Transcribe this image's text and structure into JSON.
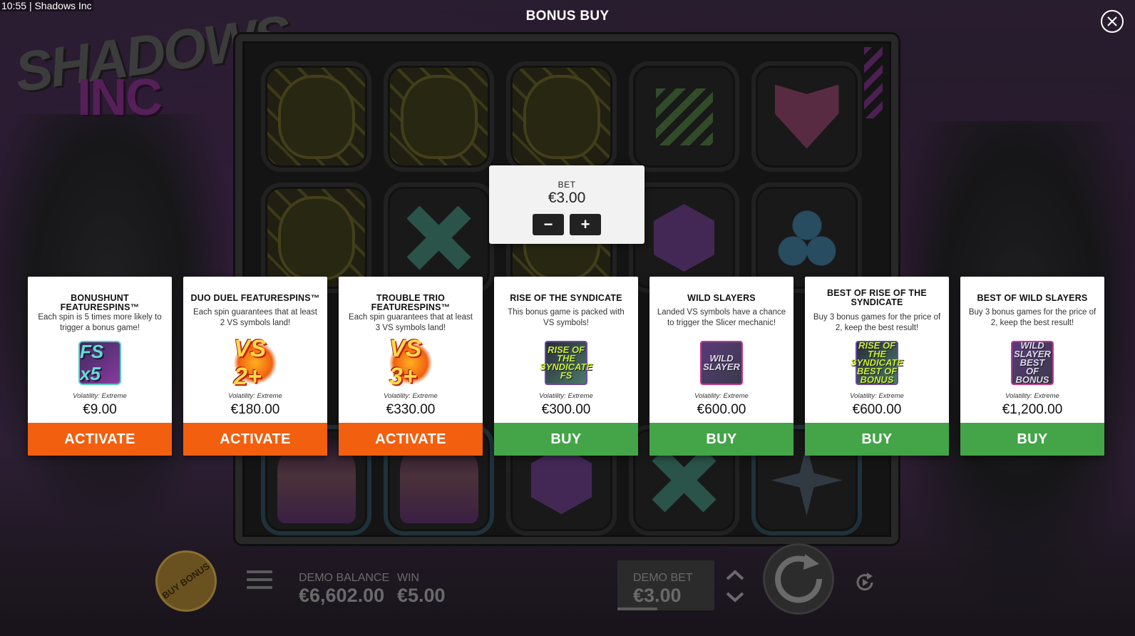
{
  "status_bar": {
    "time": "10:55",
    "app": "Shadows Inc"
  },
  "header": {
    "title": "BONUS BUY"
  },
  "logo": {
    "line1": "SHADOWS",
    "line2": "INC"
  },
  "bet": {
    "label": "BET",
    "value": "€3.00",
    "minus": "−",
    "plus": "+"
  },
  "cards": [
    {
      "title": "BONUSHUNT FEATURESPINS™",
      "desc": "Each spin is 5 times more likely to trigger a bonus game!",
      "badge": "FS x5",
      "volatility": "Volatility: Extreme",
      "price": "€9.00",
      "button": "ACTIVATE"
    },
    {
      "title": "DUO DUEL FEATURESPINS™",
      "desc": "Each spin guarantees that at least 2 VS symbols land!",
      "badge": "VS 2+",
      "volatility": "Volatility: Extreme",
      "price": "€180.00",
      "button": "ACTIVATE"
    },
    {
      "title": "TROUBLE TRIO FEATURESPINS™",
      "desc": "Each spin guarantees that at least 3 VS symbols land!",
      "badge": "VS 3+",
      "volatility": "Volatility: Extreme",
      "price": "€330.00",
      "button": "ACTIVATE"
    },
    {
      "title": "RISE OF THE SYNDICATE",
      "desc": "This bonus game is packed with VS symbols!",
      "badge": "RISE OF THE SYNDICATE FS",
      "volatility": "Volatility: Extreme",
      "price": "€300.00",
      "button": "BUY"
    },
    {
      "title": "WILD SLAYERS",
      "desc": "Landed VS symbols have a chance to trigger the Slicer mechanic!",
      "badge": "WILD SLAYER",
      "volatility": "Volatility: Extreme",
      "price": "€600.00",
      "button": "BUY"
    },
    {
      "title": "BEST OF RISE OF THE SYNDICATE",
      "desc": "Buy 3 bonus games for the price of 2, keep the best result!",
      "badge": "RISE OF THE SYNDICATE BEST OF BONUS",
      "volatility": "Volatility: Extreme",
      "price": "€600.00",
      "button": "BUY"
    },
    {
      "title": "BEST OF WILD SLAYERS",
      "desc": "Buy 3 bonus games for the price of 2, keep the best result!",
      "badge": "WILD SLAYER BEST OF BONUS",
      "volatility": "Volatility: Extreme",
      "price": "€1,200.00",
      "button": "BUY"
    }
  ],
  "hud": {
    "buy_bonus": "BUY BONUS",
    "demo_balance_label": "DEMO BALANCE",
    "demo_balance_value": "€6,602.00",
    "win_label": "WIN",
    "win_value": "€5.00",
    "demo_bet_label": "DEMO BET",
    "demo_bet_value": "€3.00"
  },
  "colors": {
    "activate": "#f25f0f",
    "buy": "#43a547",
    "accent_purple": "#9b3a9f"
  },
  "icons": {
    "close": "close-icon",
    "menu": "hamburger-menu-icon",
    "spin": "spin-icon",
    "autoplay": "autoplay-icon",
    "bet_arrows": "chevron-up-down-icon"
  }
}
